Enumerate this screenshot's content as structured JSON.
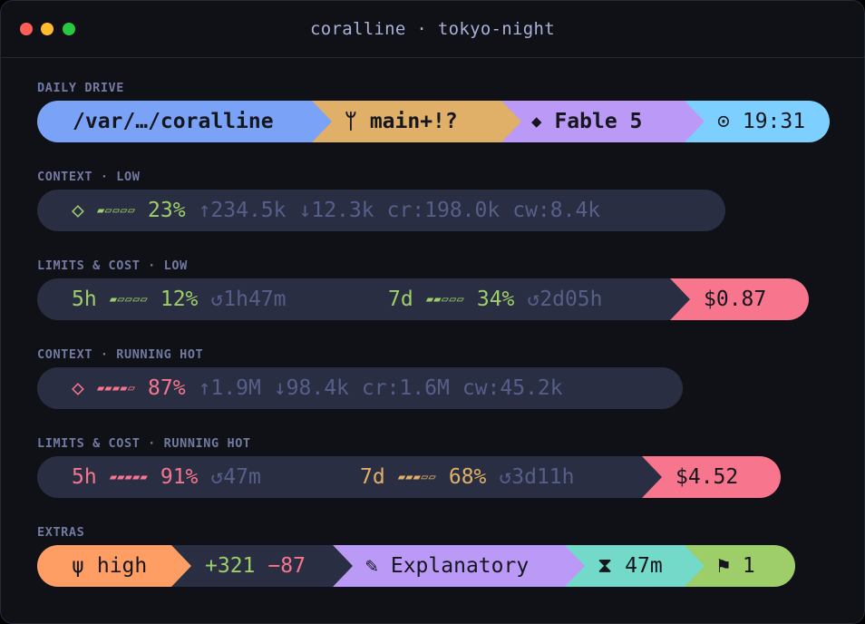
{
  "window": {
    "title": "coralline · tokyo-night"
  },
  "colors": {
    "bg": "#0f1117",
    "dim_segment": "#292e42",
    "blue": "#7aa2f7",
    "yellow": "#e0af68",
    "purple": "#bb9af7",
    "cyan": "#7dcfff",
    "green": "#9ece6a",
    "red": "#f7768e",
    "orange": "#ff9e64",
    "teal": "#73daca",
    "muted": "#565f89"
  },
  "sections": {
    "daily_drive": {
      "label": "DAILY DRIVE",
      "path": "/var/…/coralline",
      "git_icon": "ᛘ",
      "branch": "main+!?",
      "model_icon": "◆",
      "model": "Fable 5",
      "clock_icon": "⊙",
      "time": "19:31"
    },
    "context_low": {
      "label": "CONTEXT · LOW",
      "icon": "◇",
      "meter": "▰▱▱▱▱",
      "percent": "23%",
      "tokens_in": "↑234.5k",
      "tokens_out": "↓12.3k",
      "cache_read": "cr:198.0k",
      "cache_write": "cw:8.4k"
    },
    "limits_low": {
      "label": "LIMITS & COST · LOW",
      "five_h": {
        "name": "5h",
        "meter": "▰▱▱▱▱",
        "percent": "12%",
        "reset": "↺1h47m"
      },
      "seven_d": {
        "name": "7d",
        "meter": "▰▰▱▱▱",
        "percent": "34%",
        "reset": "↺2d05h"
      },
      "cost": "$0.87"
    },
    "context_hot": {
      "label": "CONTEXT · RUNNING HOT",
      "icon": "◇",
      "meter": "▰▰▰▰▱",
      "percent": "87%",
      "tokens_in": "↑1.9M",
      "tokens_out": "↓98.4k",
      "cache_read": "cr:1.6M",
      "cache_write": "cw:45.2k"
    },
    "limits_hot": {
      "label": "LIMITS & COST · RUNNING HOT",
      "five_h": {
        "name": "5h",
        "meter": "▰▰▰▰▰",
        "percent": "91%",
        "reset": "↺47m"
      },
      "seven_d": {
        "name": "7d",
        "meter": "▰▰▰▱▱",
        "percent": "68%",
        "reset": "↺3d11h"
      },
      "cost": "$4.52"
    },
    "extras": {
      "label": "EXTRAS",
      "effort_icon": "ψ",
      "effort": "high",
      "lines_added": "+321",
      "lines_removed": "−87",
      "style_icon": "✎",
      "style": "Explanatory",
      "timer_icon": "⧗",
      "duration": "47m",
      "flag_icon": "⚑",
      "flag_count": "1"
    }
  }
}
